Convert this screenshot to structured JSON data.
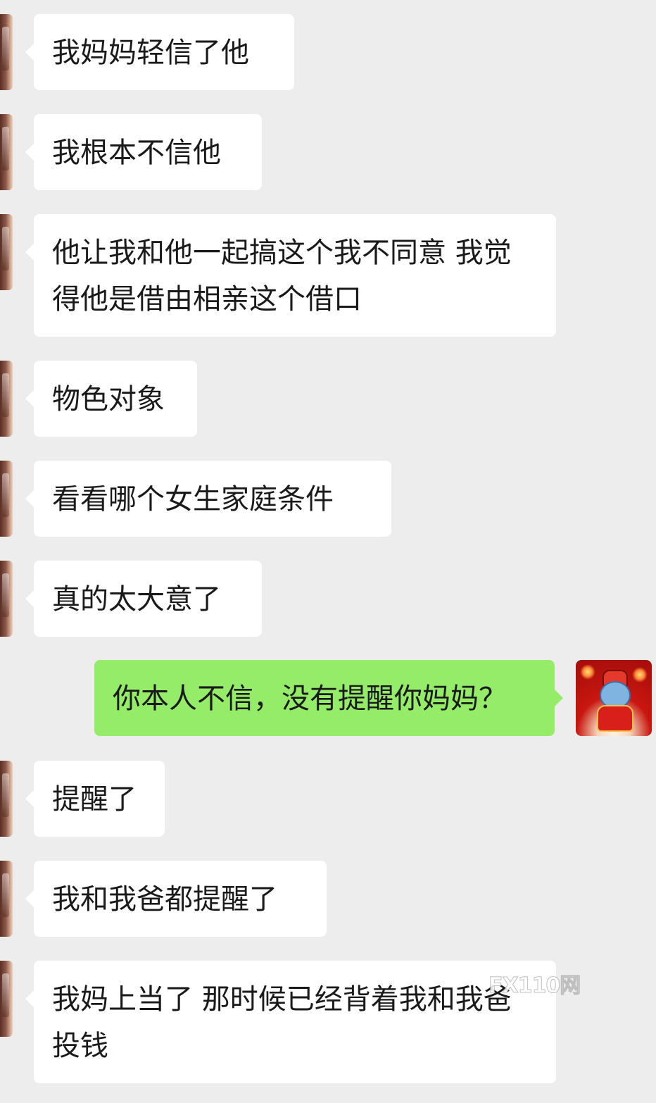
{
  "messages": [
    {
      "side": "in",
      "text": "我妈妈轻信了他"
    },
    {
      "side": "in",
      "text": "我根本不信他"
    },
    {
      "side": "in",
      "text": "他让我和他一起搞这个我不同意 我觉得他是借由相亲这个借口"
    },
    {
      "side": "in",
      "text": "物色对象"
    },
    {
      "side": "in",
      "text": "看看哪个女生家庭条件"
    },
    {
      "side": "in",
      "text": "真的太大意了"
    },
    {
      "side": "out",
      "text": "你本人不信，没有提醒你妈妈？"
    },
    {
      "side": "in",
      "text": "提醒了"
    },
    {
      "side": "in",
      "text": "我和我爸都提醒了"
    },
    {
      "side": "in",
      "text": "我妈上当了 那时候已经背着我和我爸投钱"
    }
  ],
  "watermark": "FX110网",
  "colors": {
    "background": "#ededed",
    "incoming_bubble": "#ffffff",
    "outgoing_bubble": "#95ec69"
  },
  "icons": {
    "contact_avatar": "user-photo-avatar",
    "self_avatar": "new-year-mascot-avatar"
  }
}
